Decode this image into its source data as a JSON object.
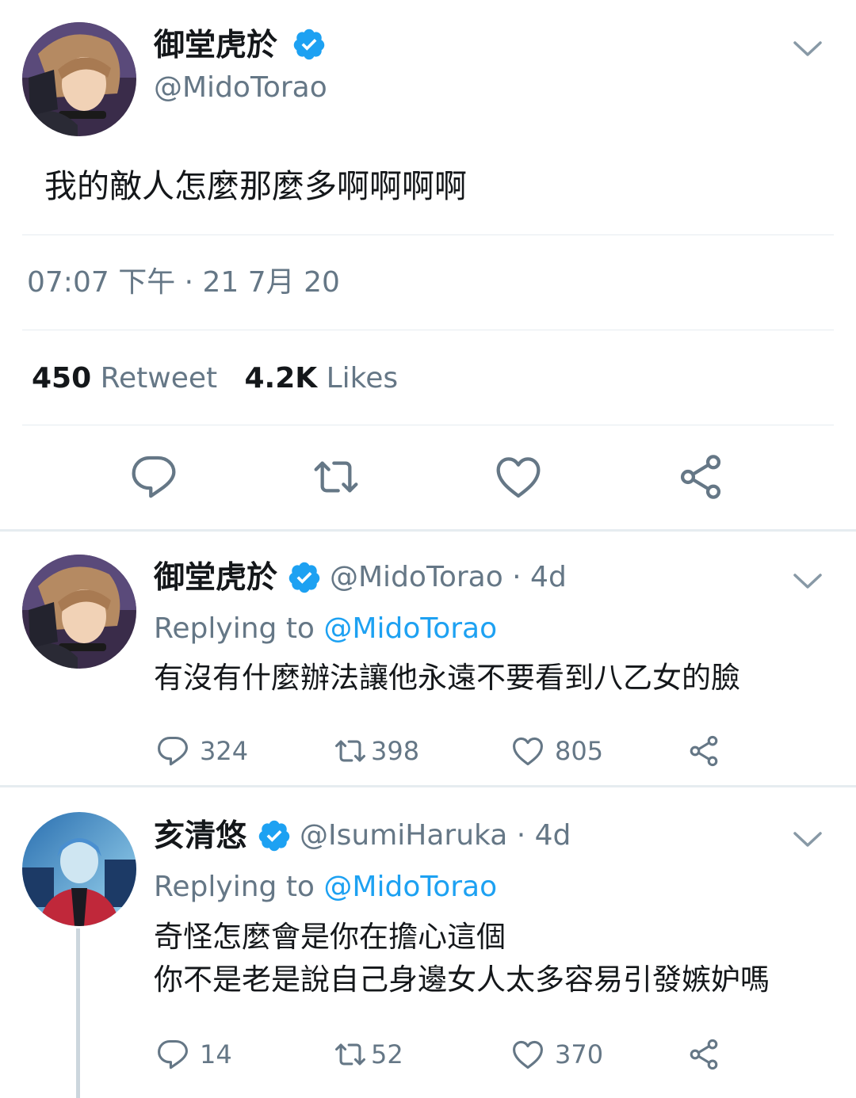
{
  "main_tweet": {
    "author_name": "御堂虎於",
    "handle": "@MidoTorao",
    "text": "我的敵人怎麼那麼多啊啊啊啊",
    "timestamp": "07:07 下午 · 21 7月 20",
    "retweet_count": "450",
    "retweet_label": "Retweet",
    "likes_count": "4.2K",
    "likes_label": "Likes"
  },
  "replies": [
    {
      "author_name": "御堂虎於",
      "handle_time": "@MidoTorao · 4d",
      "replying_prefix": "Replying to",
      "replying_to": "@MidoTorao",
      "lines": [
        "有沒有什麼辦法讓他永遠不要看到八乙女的臉"
      ],
      "reply_count": "324",
      "retweet_count": "398",
      "like_count": "805"
    },
    {
      "author_name": "亥清悠",
      "handle_time": "@IsumiHaruka · 4d",
      "replying_prefix": "Replying to",
      "replying_to": "@MidoTorao",
      "lines": [
        "奇怪怎麼會是你在擔心這個",
        "你不是老是說自己身邊女人太多容易引發嫉妒嗎"
      ],
      "reply_count": "14",
      "retweet_count": "52",
      "like_count": "370"
    }
  ],
  "colors": {
    "accent": "#1da1f2",
    "secondary_text": "#657786",
    "primary_text": "#14171a",
    "divider": "#e6ecf0"
  },
  "icons": [
    "verified-badge-icon",
    "chevron-down-icon",
    "reply-icon",
    "retweet-icon",
    "like-icon",
    "share-icon"
  ]
}
